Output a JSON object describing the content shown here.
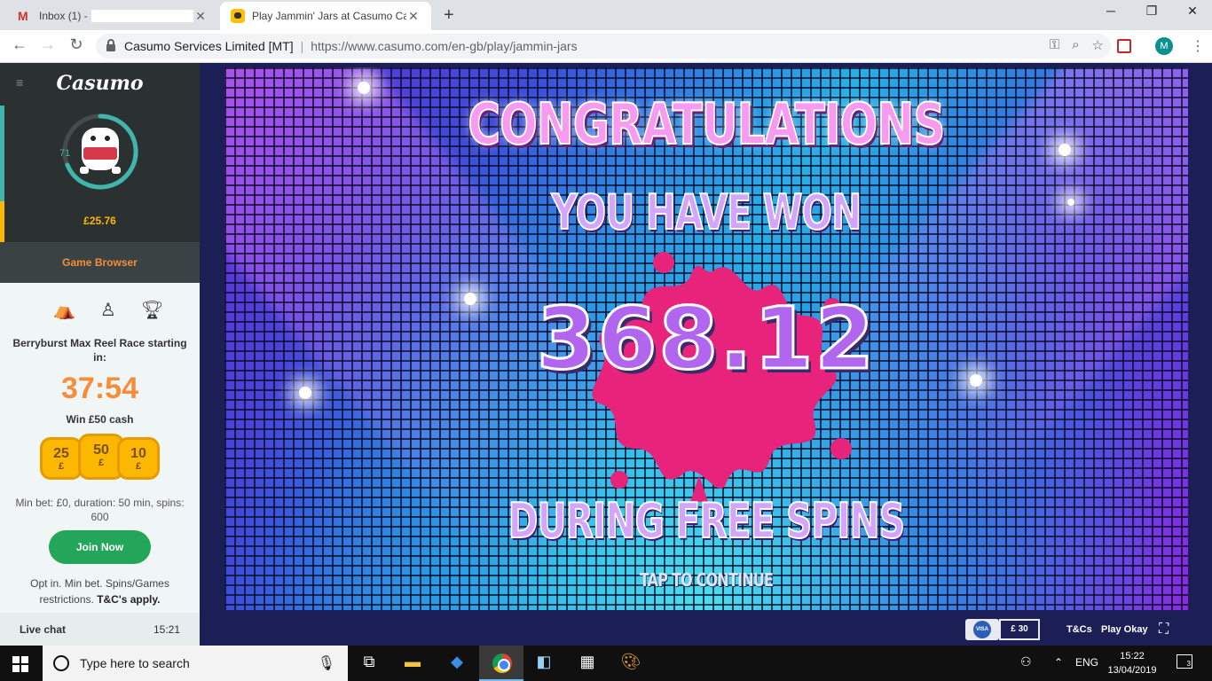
{
  "browser": {
    "tabs": [
      {
        "title": "Inbox (1) -",
        "redacted": true
      },
      {
        "title": "Play Jammin' Jars at Casumo Cas"
      }
    ],
    "address": {
      "org": "Casumo Services Limited [MT]",
      "url": "https://www.casumo.com/en-gb/play/jammin-jars"
    },
    "profile_initial": "M"
  },
  "sidebar": {
    "logo": "Casumo",
    "level": "71",
    "balance": "£25.76",
    "game_browser": "Game Browser",
    "race": {
      "title": "Berryburst Max Reel Race starting in:",
      "timer": "37:54",
      "prize": "Win £50 cash",
      "coins": [
        {
          "value": "25",
          "symbol": "£"
        },
        {
          "value": "50",
          "symbol": "£"
        },
        {
          "value": "10",
          "symbol": "£"
        }
      ],
      "rules": "Min bet: £0, duration: 50 min, spins: 600",
      "join_label": "Join Now",
      "optin_text": "Opt in. Min bet. Spins/Games restrictions.",
      "optin_tc": "T&C's apply."
    },
    "live_chat": {
      "label": "Live chat",
      "time": "15:21"
    }
  },
  "game": {
    "headline": "CONGRATULATIONS",
    "subhead": "YOU HAVE WON",
    "amount": "368.12",
    "during": "DURING FREE SPINS",
    "tap": "TAP TO CONTINUE"
  },
  "game_footer": {
    "visa": "VISA",
    "deposit": "£ 30",
    "tcs": "T&Cs",
    "play_okay": "Play Okay"
  },
  "taskbar": {
    "search_placeholder": "Type here to search",
    "language": "ENG",
    "time": "15:22",
    "date": "13/04/2019",
    "notifications": "3"
  }
}
